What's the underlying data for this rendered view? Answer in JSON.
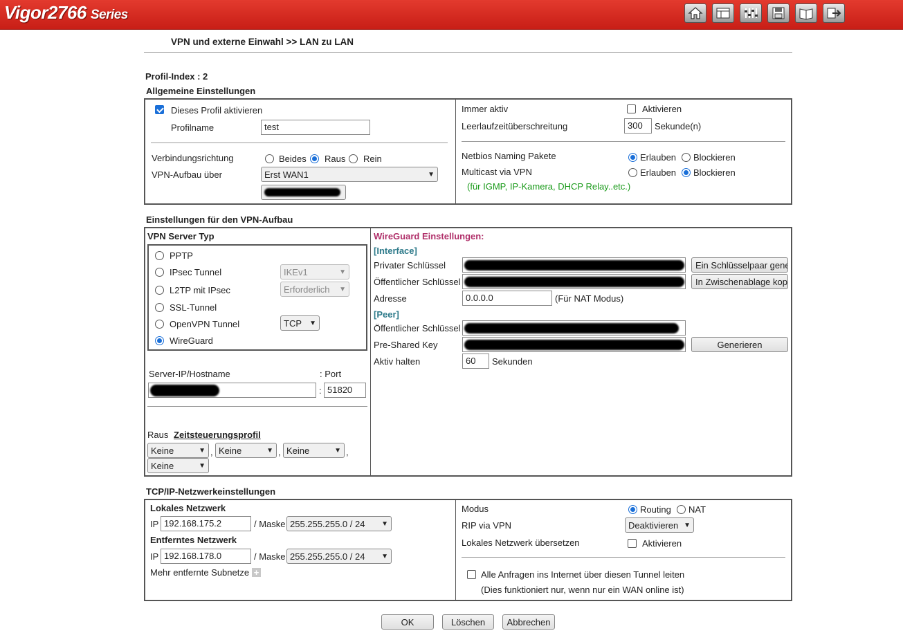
{
  "brand": {
    "name": "Vigor2766",
    "series": "Series"
  },
  "toolbar": {
    "icons": [
      "home-icon",
      "layout-icon",
      "settings-sliders-icon",
      "save-icon",
      "book-icon",
      "logout-icon"
    ]
  },
  "breadcrumb": "VPN und externe Einwahl >> LAN zu LAN",
  "profile_index": "Profil-Index : 2",
  "general": {
    "title": "Allgemeine Einstellungen",
    "enable_label": "Dieses Profil aktivieren",
    "enable_checked": true,
    "profilname_label": "Profilname",
    "profilname_value": "test",
    "direction_label": "Verbindungsrichtung",
    "direction_options": [
      "Beides",
      "Raus",
      "Rein"
    ],
    "direction_selected": "Raus",
    "vpn_via_label": "VPN-Aufbau über",
    "vpn_via_value": "Erst WAN1",
    "always_on_label": "Immer aktiv",
    "always_on_option": "Aktivieren",
    "always_on_checked": false,
    "idle_label": "Leerlaufzeitüberschreitung",
    "idle_value": "300",
    "idle_unit": "Sekunde(n)",
    "netbios_label": "Netbios Naming Pakete",
    "netbios_options": [
      "Erlauben",
      "Blockieren"
    ],
    "netbios_selected": "Erlauben",
    "multicast_label": "Multicast via VPN",
    "multicast_options": [
      "Erlauben",
      "Blockieren"
    ],
    "multicast_selected": "Blockieren",
    "multicast_note": "(für IGMP, IP-Kamera, DHCP Relay..etc.)"
  },
  "vpn_setup": {
    "title": "Einstellungen für den VPN-Aufbau",
    "server_type_title": "VPN Server Typ",
    "types": [
      {
        "label": "PPTP",
        "selected": false,
        "extra": ""
      },
      {
        "label": "IPsec Tunnel",
        "selected": false,
        "extra": "IKEv1"
      },
      {
        "label": "L2TP mit IPsec",
        "selected": false,
        "extra": "Erforderlich"
      },
      {
        "label": "SSL-Tunnel",
        "selected": false,
        "extra": ""
      },
      {
        "label": "OpenVPN Tunnel",
        "selected": false,
        "extra": "TCP"
      },
      {
        "label": "WireGuard",
        "selected": true,
        "extra": ""
      }
    ],
    "server_label": "Server-IP/Hostname",
    "port_label": ": Port",
    "port_sep": ":",
    "port_value": "51820",
    "raus_label": "Raus",
    "schedule_link": "Zeitsteuerungsprofil",
    "schedule_values": [
      "Keine",
      "Keine",
      "Keine",
      "Keine"
    ],
    "comma": ","
  },
  "wireguard": {
    "title": "WireGuard Einstellungen:",
    "interface_label": "[Interface]",
    "private_key_label": "Privater Schlüssel",
    "public_key_label": "Öffentlicher Schlüssel",
    "keypair_button": "Ein Schlüsselpaar gene",
    "clipboard_button": "In Zwischenablage kopi",
    "address_label": "Adresse",
    "address_value": "0.0.0.0",
    "address_note": "(Für NAT Modus)",
    "peer_label": "[Peer]",
    "peer_public_key_label": "Öffentlicher Schlüssel",
    "psk_label": "Pre-Shared Key",
    "generate_button": "Generieren",
    "keepalive_label": "Aktiv halten",
    "keepalive_value": "60",
    "keepalive_unit": "Sekunden"
  },
  "tcpip": {
    "title": "TCP/IP-Netzwerkeinstellungen",
    "local_title": "Lokales Netzwerk",
    "ip_label": "IP",
    "local_ip": "192.168.175.2",
    "mask_label": "/ Maske",
    "local_mask": "255.255.255.0 / 24",
    "remote_title": "Entferntes Netzwerk",
    "remote_ip": "192.168.178.0",
    "remote_mask": "255.255.255.0 / 24",
    "more_subnets": "Mehr entfernte Subnetze",
    "mode_label": "Modus",
    "mode_options": [
      "Routing",
      "NAT"
    ],
    "mode_selected": "Routing",
    "rip_label": "RIP via VPN",
    "rip_value": "Deaktivieren",
    "translate_label": "Lokales Netzwerk übersetzen",
    "translate_option": "Aktivieren",
    "translate_checked": false,
    "all_internet_label": "Alle Anfragen ins Internet über diesen Tunnel leiten",
    "all_internet_checked": false,
    "all_internet_note": "(Dies funktioniert nur, wenn nur ein WAN online ist)"
  },
  "buttons": {
    "ok": "OK",
    "delete": "Löschen",
    "cancel": "Abbrechen"
  }
}
